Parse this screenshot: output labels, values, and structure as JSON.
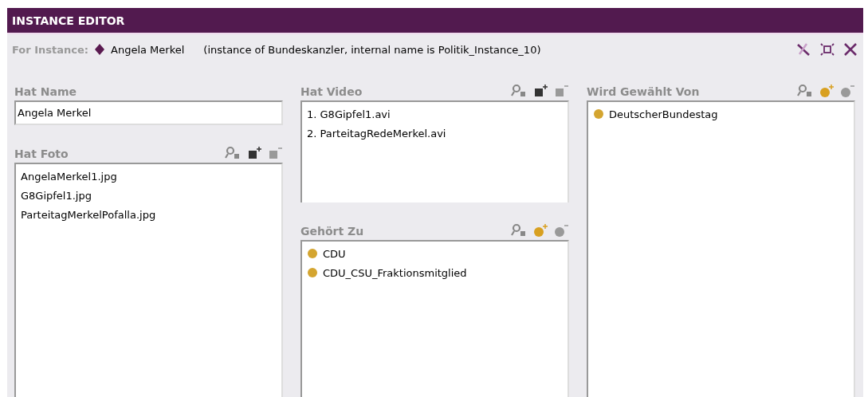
{
  "window": {
    "title": "INSTANCE EDITOR"
  },
  "instance_bar": {
    "label": "For Instance:",
    "name": "Angela Merkel",
    "description": "(instance of Bundeskanzler, internal name is Politik_Instance_10)"
  },
  "columns": [
    [
      {
        "label": "Hat Name",
        "kind": "field",
        "value": "Angela Merkel"
      },
      {
        "label": "Hat Foto",
        "kind": "instance_list",
        "items": [
          "AngelaMerkel1.jpg",
          "G8Gipfel1.jpg",
          "ParteitagMerkelPofalla.jpg"
        ]
      }
    ],
    [
      {
        "label": "Hat Video",
        "kind": "instance_list",
        "items": [
          "1. G8Gipfel1.avi",
          "2. ParteitagRedeMerkel.avi"
        ]
      },
      {
        "label": "Gehört Zu",
        "kind": "class_list",
        "items": [
          "CDU",
          "CDU_CSU_Fraktionsmitglied"
        ]
      }
    ],
    [
      {
        "label": "Wird Gewählt Von",
        "kind": "class_list",
        "items": [
          "DeutscherBundestag"
        ]
      }
    ]
  ]
}
